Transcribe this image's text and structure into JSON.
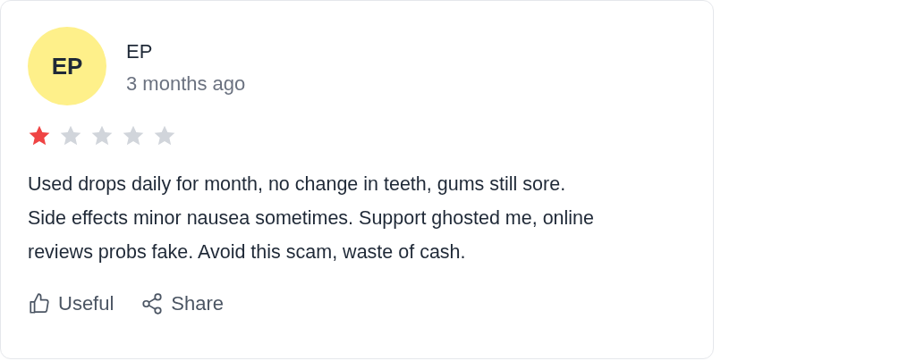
{
  "review": {
    "avatar_initials": "EP",
    "author": "EP",
    "time": "3 months ago",
    "stars": 1,
    "text": "Used drops daily for month, no change in teeth, gums still sore. Side effects minor nausea sometimes. Support ghosted me, online reviews probs fake. Avoid this scam, waste of cash.",
    "actions": [
      {
        "kind": "useful",
        "label": "Useful"
      },
      {
        "kind": "share",
        "label": "Share"
      }
    ]
  }
}
